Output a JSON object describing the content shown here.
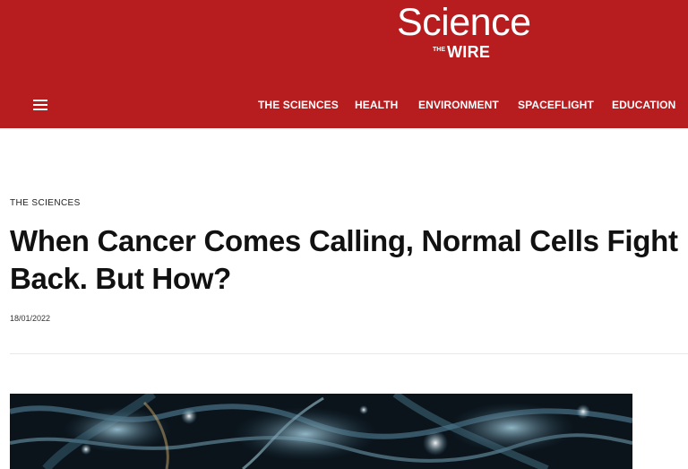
{
  "site": {
    "logo_main": "Science",
    "logo_the": "THE",
    "logo_wire": "WIRE",
    "brand_color": "#b71c1f"
  },
  "nav": {
    "menu_icon": "hamburger-menu-icon",
    "items": [
      {
        "label": "THE SCIENCES"
      },
      {
        "label": "HEALTH"
      },
      {
        "label": "ENVIRONMENT"
      },
      {
        "label": "SPACEFLIGHT"
      },
      {
        "label": "EDUCATION"
      }
    ]
  },
  "article": {
    "category": "THE SCIENCES",
    "title": "When Cancer Comes Calling, Normal Cells Fight Back. But How?",
    "date": "18/01/2022",
    "hero_image": "microscopy-cells-image"
  }
}
